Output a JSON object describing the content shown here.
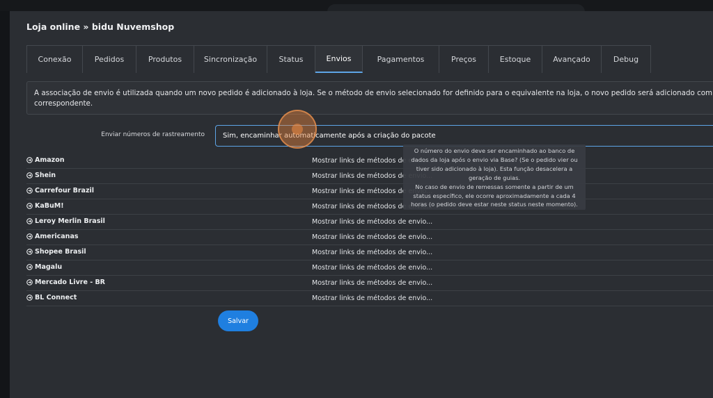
{
  "window": {
    "title": "Loja online » bidu Nuvemshop"
  },
  "tabs": [
    {
      "label": "Conexão",
      "active": false
    },
    {
      "label": "Pedidos",
      "active": false
    },
    {
      "label": "Produtos",
      "active": false
    },
    {
      "label": "Sincronização",
      "active": false
    },
    {
      "label": "Status",
      "active": false
    },
    {
      "label": "Envios",
      "active": true
    },
    {
      "label": "Pagamentos",
      "active": false
    },
    {
      "label": "Preços",
      "active": false
    },
    {
      "label": "Estoque",
      "active": false
    },
    {
      "label": "Avançado",
      "active": false
    },
    {
      "label": "Debug",
      "active": false
    }
  ],
  "info": {
    "line1": "A associação de envio é utilizada quando um novo pedido é adicionado à loja. Se o método de envio selecionado for definido para o equivalente na loja, o novo pedido será adicionado com o tipo de envio",
    "line2": "correspondente."
  },
  "tracking": {
    "label": "Enviar números de rastreamento",
    "value": "Sim, encaminhar automaticamente após a criação do pacote"
  },
  "marketplaces": {
    "link_label": "Mostrar links de métodos de envio...",
    "items": [
      {
        "name": "Amazon"
      },
      {
        "name": "Shein"
      },
      {
        "name": "Carrefour Brazil"
      },
      {
        "name": "KaBuM!"
      },
      {
        "name": "Leroy Merlin Brasil"
      },
      {
        "name": "Americanas"
      },
      {
        "name": "Shopee Brasil"
      },
      {
        "name": "Magalu"
      },
      {
        "name": "Mercado Livre - BR"
      },
      {
        "name": "BL Connect"
      }
    ]
  },
  "tooltip": {
    "lines": [
      "O número do envio deve ser encaminhado ao banco de",
      "dados da loja após o envio via Base? (Se o pedido vier ou",
      "tiver sido adicionado à loja). Esta função desacelera a",
      "geração de guias.",
      "No caso de envio de remessas somente a partir de um",
      "status específico, ele ocorre aproximadamente a cada 4",
      "horas (o pedido deve estar neste status neste momento)."
    ]
  },
  "actions": {
    "save_label": "Salvar"
  },
  "colors": {
    "accent": "#5ea6e8",
    "button": "#1f7fe0",
    "background": "#2b2e33"
  },
  "icons": {
    "row_icon": "circle-arrow-right-icon"
  }
}
